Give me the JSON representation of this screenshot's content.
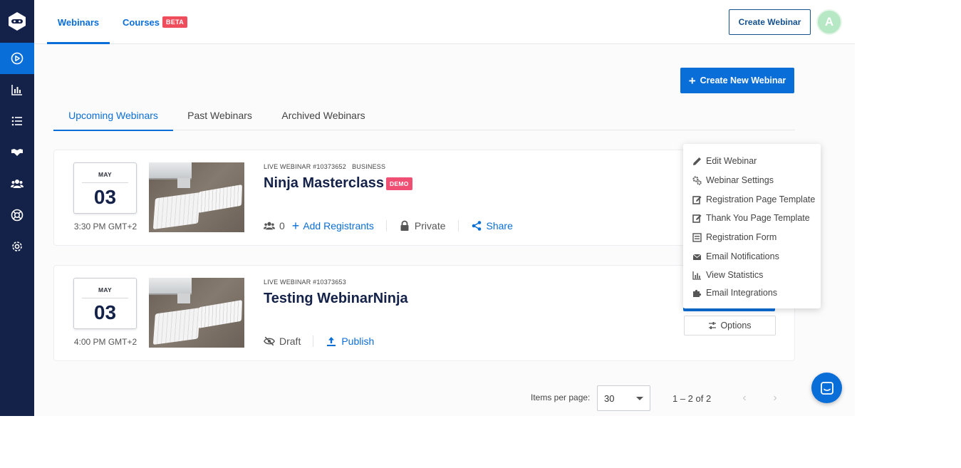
{
  "colors": {
    "brand_blue": "#0a6ed8",
    "sidebar_navy": "#14224a",
    "beta_red": "#ef4c5c",
    "demo_pink": "#f04f74",
    "avatar_green": "#b7e8c5"
  },
  "sidebar": {
    "items": [
      {
        "icon": "play-circle-icon",
        "active": true
      },
      {
        "icon": "bar-chart-icon"
      },
      {
        "icon": "list-icon"
      },
      {
        "icon": "handshake-icon"
      },
      {
        "icon": "users-icon"
      },
      {
        "icon": "lifebuoy-icon"
      },
      {
        "icon": "gear-icon"
      }
    ]
  },
  "topbar": {
    "tabs": [
      {
        "label": "Webinars",
        "active": true
      },
      {
        "label": "Courses",
        "badge": "BETA"
      }
    ],
    "create_webinar_label": "Create Webinar",
    "avatar_initial": "A"
  },
  "main": {
    "create_new_label": "Create New Webinar",
    "subtabs": [
      {
        "label": "Upcoming Webinars",
        "active": true
      },
      {
        "label": "Past Webinars"
      },
      {
        "label": "Archived Webinars"
      }
    ],
    "webinars": [
      {
        "month": "MAY",
        "day": "03",
        "time": "3:30 PM GMT+2",
        "meta": "LIVE WEBINAR #10373652   BUSINESS",
        "title": "Ninja Masterclass",
        "badge": "DEMO",
        "registrants": "0",
        "add_registrants": "Add Registrants",
        "privacy": "Private",
        "share": "Share"
      },
      {
        "month": "MAY",
        "day": "03",
        "time": "4:00 PM GMT+2",
        "meta": "LIVE WEBINAR #10373653",
        "title": "Testing WebinarNinja",
        "status": "Draft",
        "publish": "Publish",
        "options": "Options"
      }
    ],
    "menu": [
      {
        "label": "Edit Webinar",
        "icon": "pencil-icon"
      },
      {
        "label": "Webinar Settings",
        "icon": "cogs-icon"
      },
      {
        "label": "Registration Page Template",
        "icon": "edit-icon"
      },
      {
        "label": "Thank You Page Template",
        "icon": "edit-icon"
      },
      {
        "label": "Registration Form",
        "icon": "form-icon"
      },
      {
        "label": "Email Notifications",
        "icon": "envelope-icon"
      },
      {
        "label": "View Statistics",
        "icon": "bar-chart-icon"
      },
      {
        "label": "Email Integrations",
        "icon": "puzzle-icon"
      }
    ],
    "pagination": {
      "items_per_page_label": "Items per page:",
      "items_per_page": "30",
      "range": "1 – 2 of 2"
    }
  }
}
